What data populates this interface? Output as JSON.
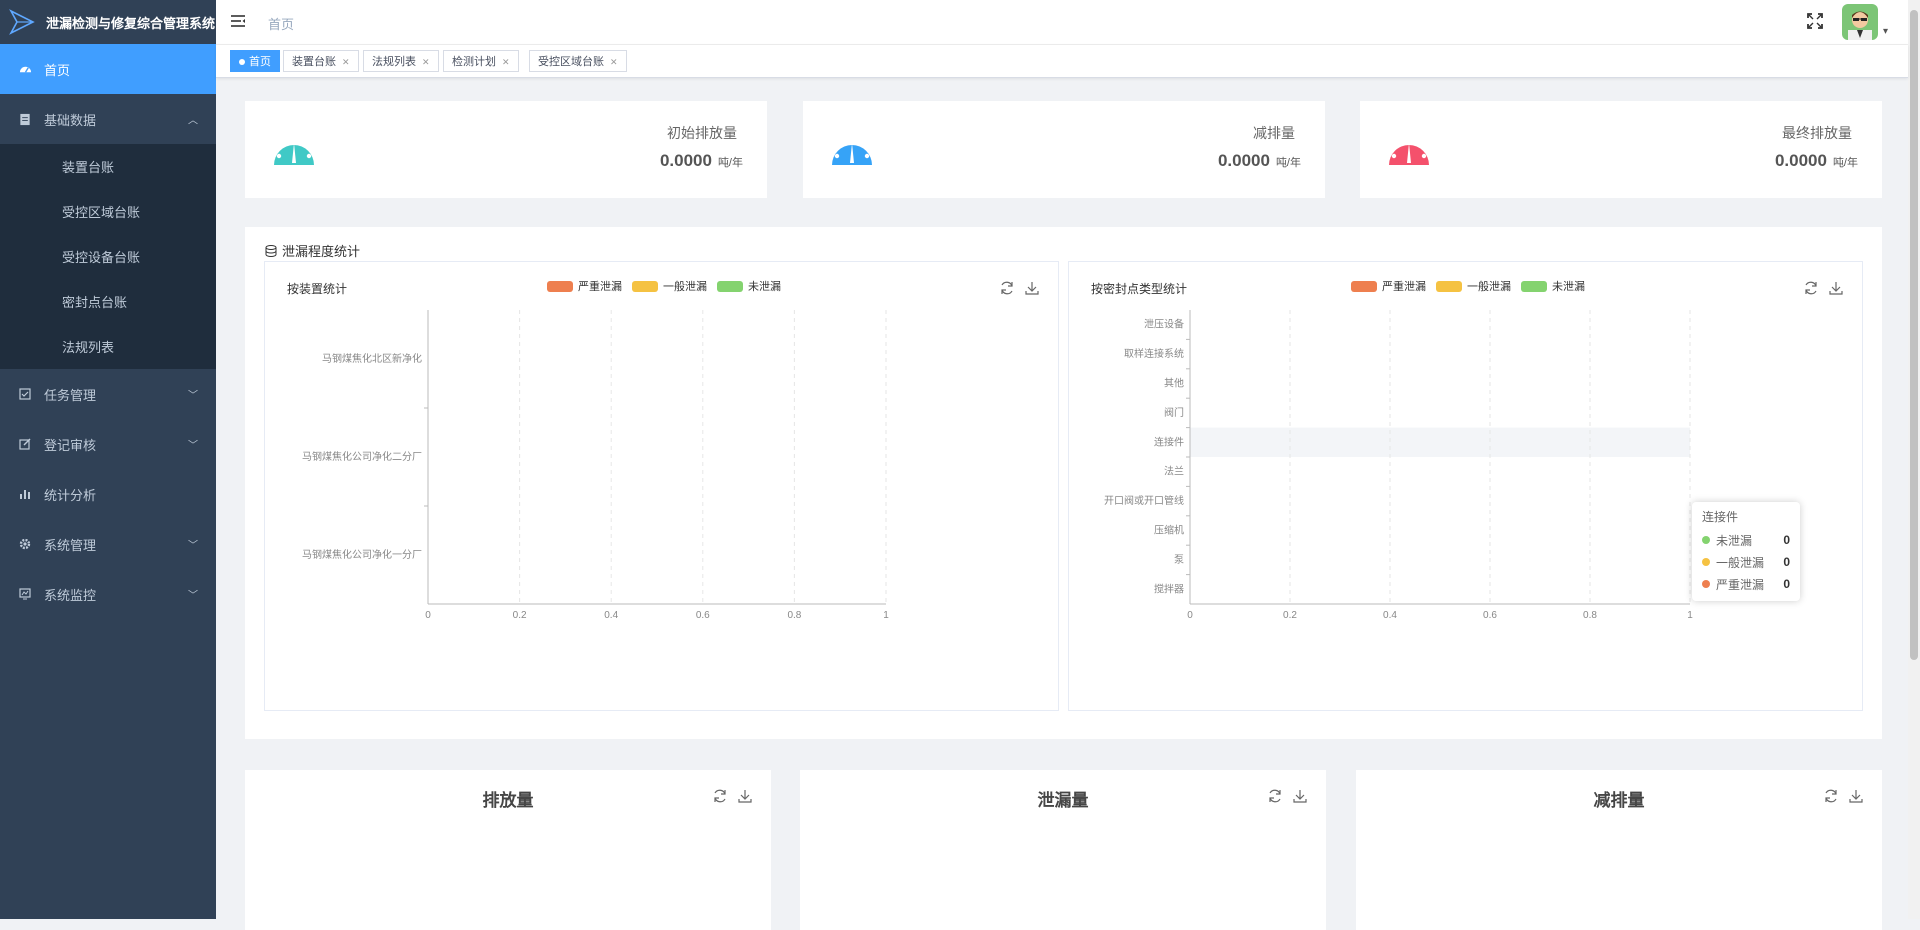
{
  "app": {
    "title": "泄漏检测与修复综合管理系统"
  },
  "sidebar": {
    "items": [
      {
        "label": "首页",
        "icon": "dashboard-icon",
        "active": true
      },
      {
        "label": "基础数据",
        "icon": "document-icon",
        "expanded": true,
        "children": [
          "装置台账",
          "受控区域台账",
          "受控设备台账",
          "密封点台账",
          "法规列表"
        ]
      },
      {
        "label": "任务管理",
        "icon": "checkbox-icon"
      },
      {
        "label": "登记审核",
        "icon": "edit-icon"
      },
      {
        "label": "统计分析",
        "icon": "bar-chart-icon"
      },
      {
        "label": "系统管理",
        "icon": "gear-icon"
      },
      {
        "label": "系统监控",
        "icon": "monitor-icon"
      }
    ]
  },
  "header": {
    "breadcrumb": "首页"
  },
  "tags": [
    {
      "label": "首页",
      "active": true
    },
    {
      "label": "装置台账"
    },
    {
      "label": "法规列表"
    },
    {
      "label": "检测计划"
    },
    {
      "label": "受控区域台账"
    }
  ],
  "stats": [
    {
      "label": "初始排放量",
      "value": "0.0000",
      "unit": "吨/年",
      "color": "#40c9c6"
    },
    {
      "label": "减排量",
      "value": "0.0000",
      "unit": "吨/年",
      "color": "#36a3f7"
    },
    {
      "label": "最终排放量",
      "value": "0.0000",
      "unit": "吨/年",
      "color": "#f4516c"
    }
  ],
  "panel": {
    "title": "泄漏程度统计"
  },
  "legend": [
    {
      "label": "严重泄漏",
      "color": "#ee7f4f"
    },
    {
      "label": "一般泄漏",
      "color": "#f5c242"
    },
    {
      "label": "未泄漏",
      "color": "#84d36f"
    }
  ],
  "chart_data": [
    {
      "type": "bar",
      "orientation": "horizontal",
      "title": "按装置统计",
      "categories": [
        "马钢煤焦化北区新净化",
        "马钢煤焦化公司净化二分厂",
        "马钢煤焦化公司净化一分厂"
      ],
      "series": [
        {
          "name": "严重泄漏",
          "values": [
            0,
            0,
            0
          ]
        },
        {
          "name": "一般泄漏",
          "values": [
            0,
            0,
            0
          ]
        },
        {
          "name": "未泄漏",
          "values": [
            0,
            0,
            0
          ]
        }
      ],
      "xlim": [
        0,
        1
      ],
      "xticks": [
        "0",
        "0.2",
        "0.4",
        "0.6",
        "0.8",
        "1"
      ],
      "grid": true,
      "legend": "top"
    },
    {
      "type": "bar",
      "orientation": "horizontal",
      "title": "按密封点类型统计",
      "categories": [
        "泄压设备",
        "取样连接系统",
        "其他",
        "阀门",
        "连接件",
        "法兰",
        "开口阀或开口管线",
        "压缩机",
        "泵",
        "搅拌器"
      ],
      "series": [
        {
          "name": "严重泄漏",
          "values": [
            0,
            0,
            0,
            0,
            0,
            0,
            0,
            0,
            0,
            0
          ]
        },
        {
          "name": "一般泄漏",
          "values": [
            0,
            0,
            0,
            0,
            0,
            0,
            0,
            0,
            0,
            0
          ]
        },
        {
          "name": "未泄漏",
          "values": [
            0,
            0,
            0,
            0,
            0,
            0,
            0,
            0,
            0,
            0
          ]
        }
      ],
      "xlim": [
        0,
        1
      ],
      "xticks": [
        "0",
        "0.2",
        "0.4",
        "0.6",
        "0.8",
        "1"
      ],
      "grid": true,
      "legend": "top",
      "highlighted_category": "连接件",
      "tooltip": {
        "title": "连接件",
        "rows": [
          {
            "name": "未泄漏",
            "value": "0",
            "color": "#84d36f"
          },
          {
            "name": "一般泄漏",
            "value": "0",
            "color": "#f5c242"
          },
          {
            "name": "严重泄漏",
            "value": "0",
            "color": "#ee7f4f"
          }
        ]
      }
    }
  ],
  "bottom_cards": [
    {
      "title": "排放量"
    },
    {
      "title": "泄漏量"
    },
    {
      "title": "减排量"
    }
  ]
}
